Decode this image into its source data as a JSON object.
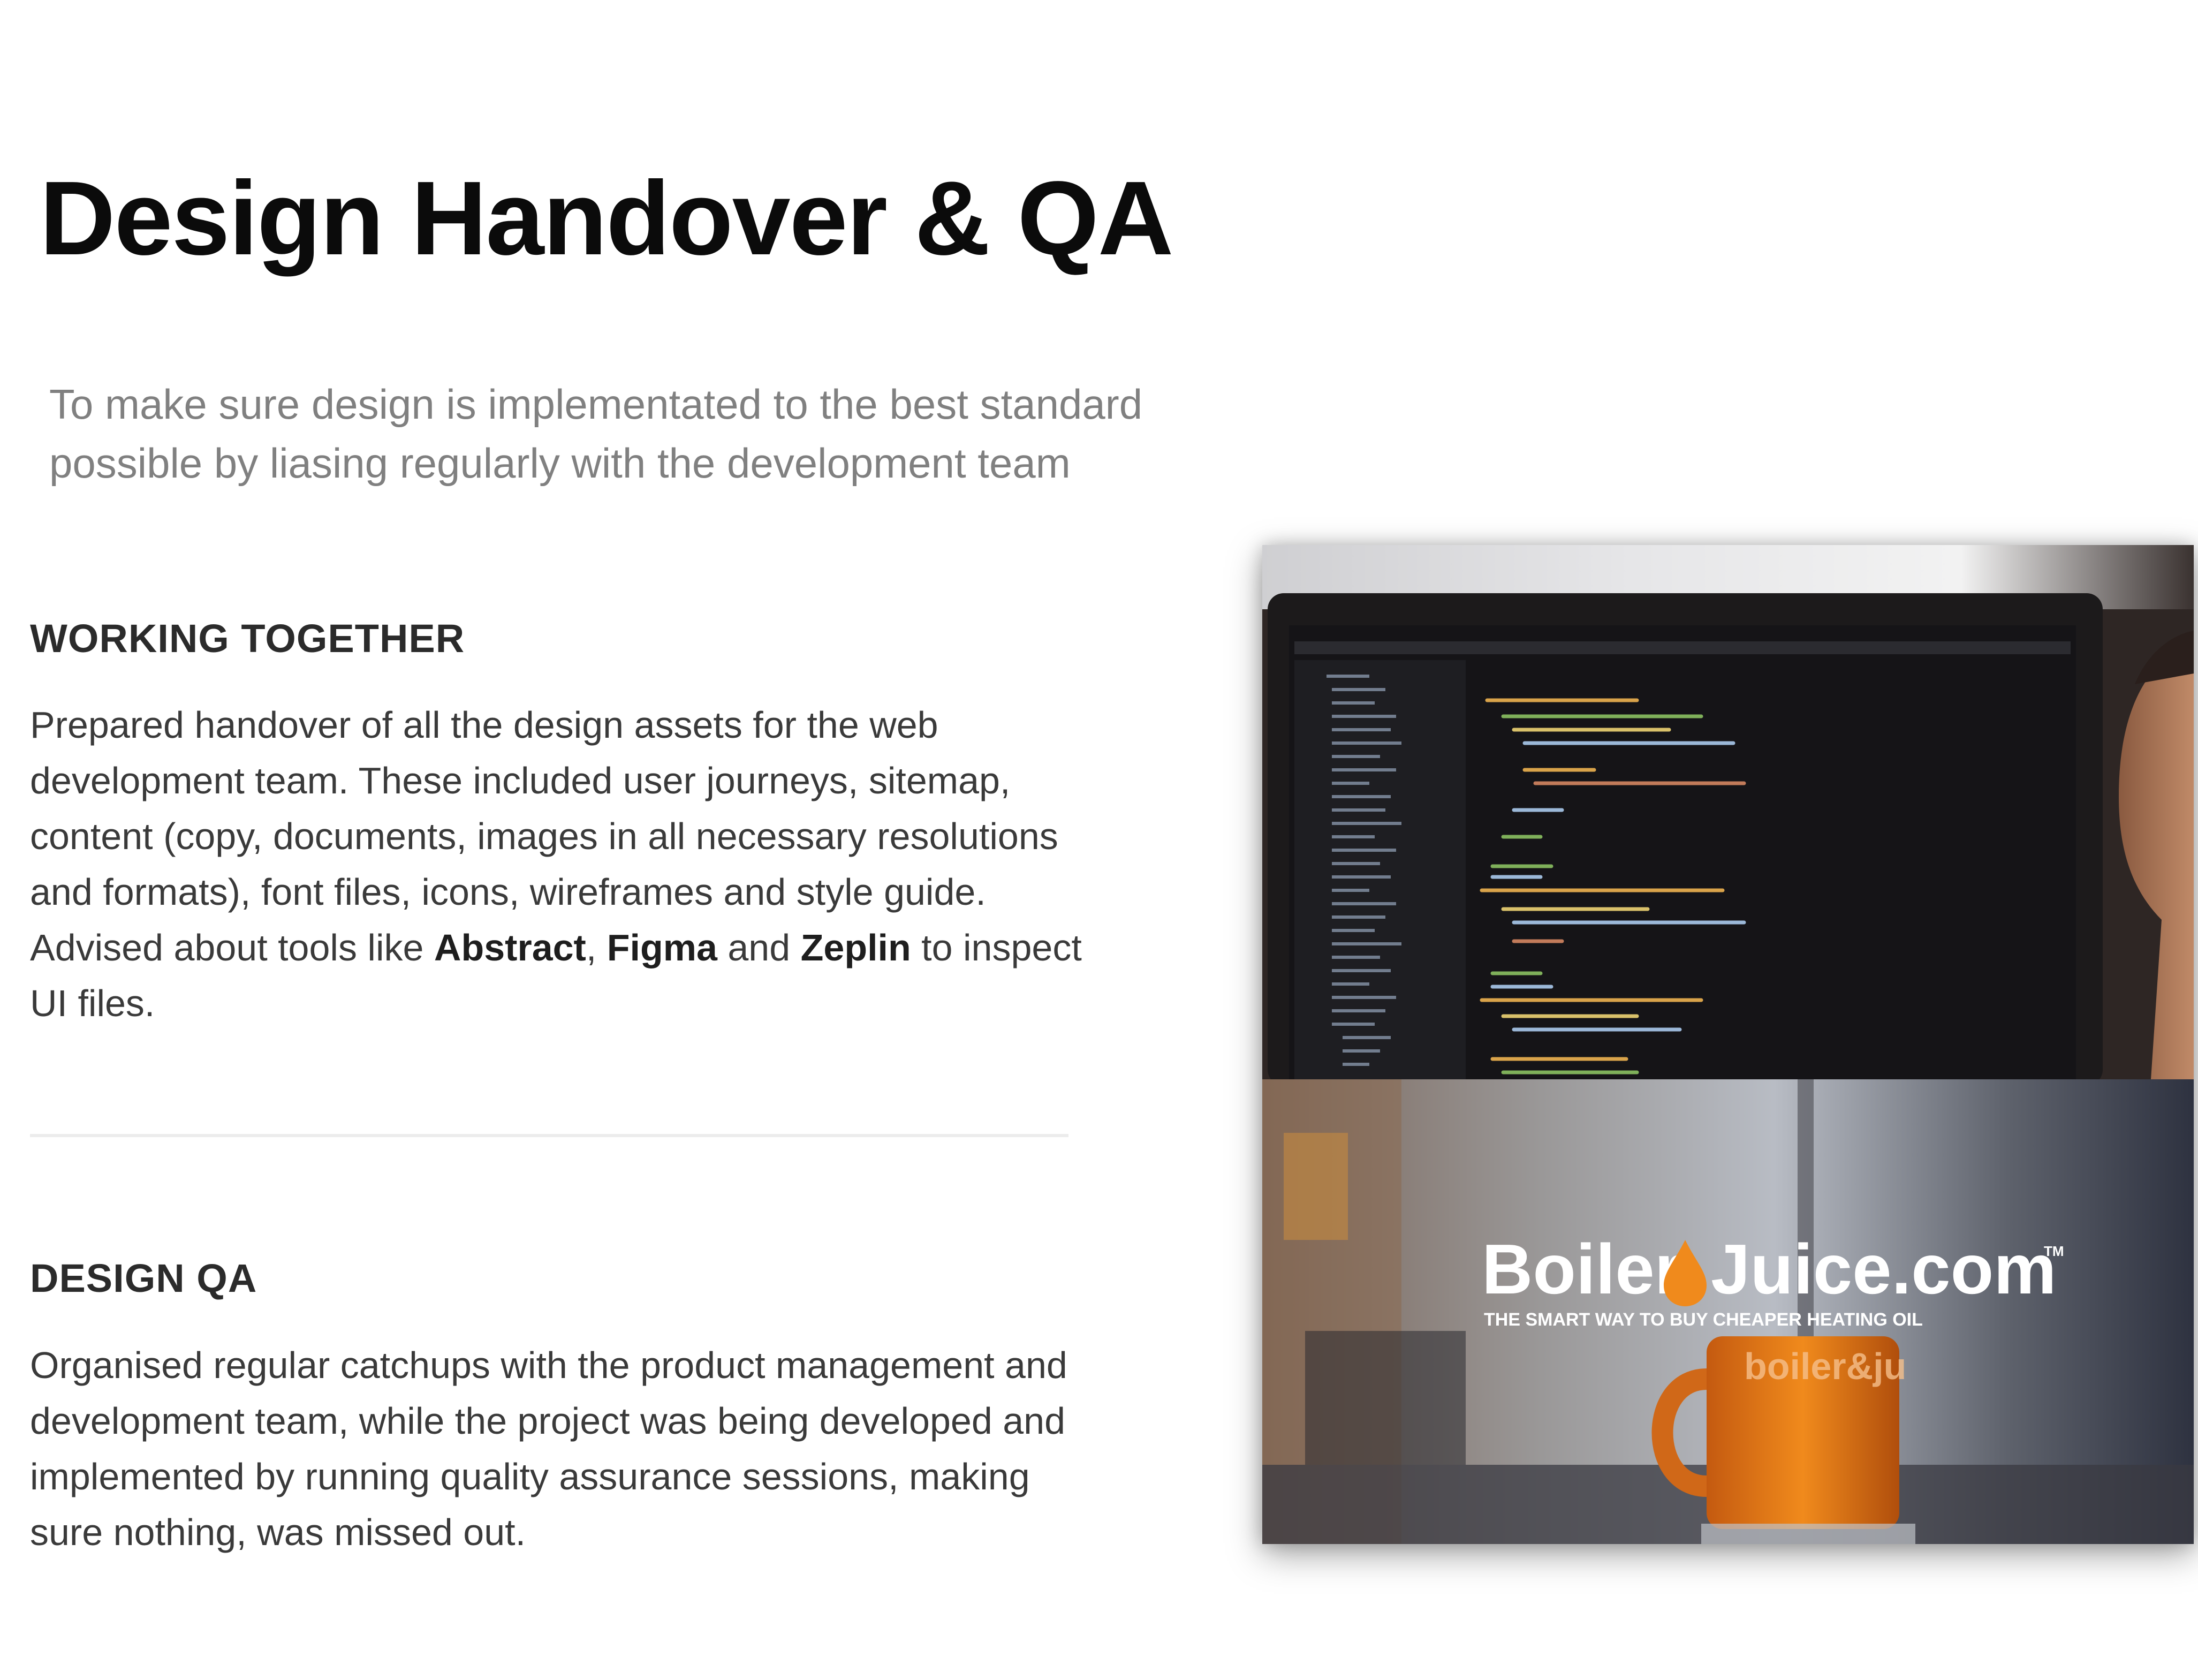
{
  "title": "Design Handover & QA",
  "intro": {
    "line1": "To make sure design is implementated to the best standard",
    "line2": "possible by liasing regularly with the development team"
  },
  "sections": [
    {
      "heading": "WORKING TOGETHER",
      "lines": {
        "l1": "Prepared handover of all the design assets for the web",
        "l2": "development team. These included user journeys, sitemap,",
        "l3": "content (copy, documents, images in all necessary resolutions",
        "l4": "and formats), font files, icons, wireframes and style guide.",
        "l5_pre": "Advised about tools like ",
        "tool1": "Abstract",
        "sep1": ", ",
        "tool2": "Figma",
        "sep2": " and ",
        "tool3": "Zeplin",
        "l5_post": " to inspect",
        "l6": "UI files."
      }
    },
    {
      "heading": "DESIGN QA",
      "lines": {
        "l1": "Organised regular catchups with the product management and",
        "l2": "development team, while the project was being developed and",
        "l3": "implemented by running quality assurance sessions, making",
        "l4": "sure nothing, was missed out."
      }
    }
  ],
  "photo": {
    "brand_left": "Boiler",
    "brand_right": "Juice.com",
    "trademark": "TM",
    "tagline": "THE SMART WAY TO BUY CHEAPER HEATING OIL",
    "mug_text": "boiler&ju"
  },
  "colors": {
    "accent_orange": "#f08a1c",
    "title": "#0b0b0b",
    "intro": "#808080"
  }
}
